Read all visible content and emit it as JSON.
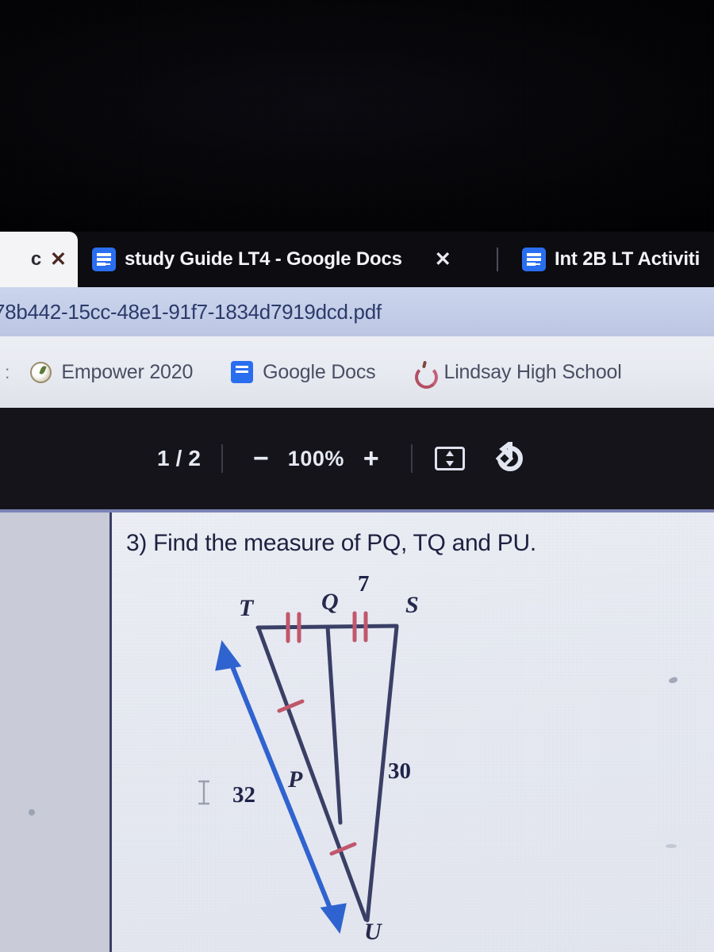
{
  "browser": {
    "tabs": [
      {
        "title": "c",
        "active": true,
        "favicon": "none",
        "close_label": "✕"
      },
      {
        "title": "study Guide LT4 - Google Docs",
        "active": false,
        "favicon": "google-docs-icon",
        "close_label": "✕"
      },
      {
        "title": "Int 2B LT Activiti",
        "active": false,
        "favicon": "google-docs-icon",
        "close_label": ""
      }
    ],
    "address": {
      "url": "78b442-15cc-48e1-91f7-1834d7919dcd.pdf"
    },
    "bookmarks": {
      "edge_label": ":",
      "items": [
        {
          "label": "Empower 2020",
          "favicon": "empower-icon"
        },
        {
          "label": "Google Docs",
          "favicon": "google-docs-icon"
        },
        {
          "label": "Lindsay High School",
          "favicon": "apple-icon"
        }
      ]
    }
  },
  "pdf_toolbar": {
    "page_current": "1",
    "page_separator": "/",
    "page_total": "2",
    "zoom_out_label": "−",
    "zoom_level": "100%",
    "zoom_in_label": "+",
    "fit_page_icon": "fit-page-icon",
    "rotate_icon": "rotate-icon"
  },
  "document": {
    "question": "3) Find the measure of PQ, TQ and PU.",
    "diagram": {
      "vertex_labels": {
        "T": "T",
        "Q": "Q",
        "S": "S",
        "P": "P",
        "U": "U"
      },
      "measurements": {
        "qs": "7",
        "su": "30",
        "annotation": "32"
      },
      "tick_marks": {
        "tq": 2,
        "qs": 2,
        "tp": 1,
        "pu": 1
      },
      "colors": {
        "stroke": "#3a3f66",
        "tick": "#c0566b",
        "annotation": "#2a5fd0"
      }
    }
  },
  "cursor": {
    "type": "text-ibeam"
  }
}
